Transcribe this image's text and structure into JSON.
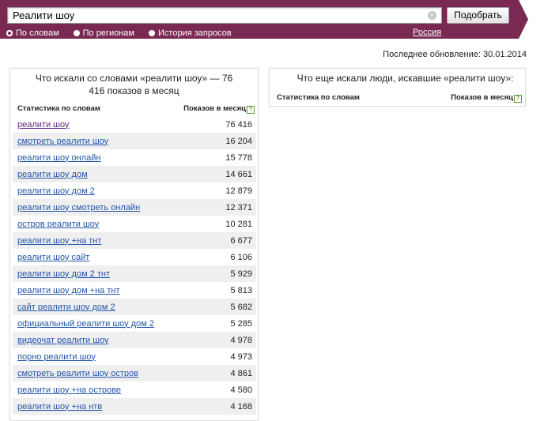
{
  "search": {
    "query": "Реалити шоу",
    "button_label": "Подобрать",
    "clear_glyph": "×"
  },
  "tabs": [
    {
      "label": "По словам",
      "selected": true
    },
    {
      "label": "По регионам",
      "selected": false
    },
    {
      "label": "История запросов",
      "selected": false
    }
  ],
  "region": "Россия",
  "updated": "Последнее обновление: 30.01.2014",
  "left_panel": {
    "title": "Что искали со словами «реалити шоу» — 76 416 показов в месяц",
    "col_words": "Статистика по словам",
    "col_impressions": "Показов в месяц",
    "help_glyph": "?",
    "rows": [
      {
        "phrase": "реалити шоу",
        "count": "76 416"
      },
      {
        "phrase": "смотреть реалити шоу",
        "count": "16 204"
      },
      {
        "phrase": "реалити шоу онлайн",
        "count": "15 778"
      },
      {
        "phrase": "реалити шоу дом",
        "count": "14 661"
      },
      {
        "phrase": "реалити шоу дом 2",
        "count": "12 879"
      },
      {
        "phrase": "реалити шоу смотреть онлайн",
        "count": "12 371"
      },
      {
        "phrase": "остров реалити шоу",
        "count": "10 281"
      },
      {
        "phrase": "реалити шоу +на тнт",
        "count": "6 677"
      },
      {
        "phrase": "реалити шоу сайт",
        "count": "6 106"
      },
      {
        "phrase": "реалити шоу дом 2 тнт",
        "count": "5 929"
      },
      {
        "phrase": "реалити шоу дом +на тнт",
        "count": "5 813"
      },
      {
        "phrase": "сайт реалити шоу дом 2",
        "count": "5 682"
      },
      {
        "phrase": "официальный реалити шоу дом 2",
        "count": "5 285"
      },
      {
        "phrase": "видеочат реалити шоу",
        "count": "4 978"
      },
      {
        "phrase": "порно реалити шоу",
        "count": "4 973"
      },
      {
        "phrase": "смотреть реалити шоу остров",
        "count": "4 861"
      },
      {
        "phrase": "реалити шоу +на острове",
        "count": "4 580"
      },
      {
        "phrase": "реалити шоу +на нтв",
        "count": "4 168"
      }
    ]
  },
  "right_panel": {
    "title": "Что еще искали люди, искавшие «реалити шоу»:",
    "col_words": "Статистика по словам",
    "col_impressions": "Показов в месяц",
    "help_glyph": "?"
  },
  "colors": {
    "band": "#7a2a52",
    "link": "#2255aa",
    "visited_link": "#5b2a86",
    "row_stripe": "#efefef"
  }
}
